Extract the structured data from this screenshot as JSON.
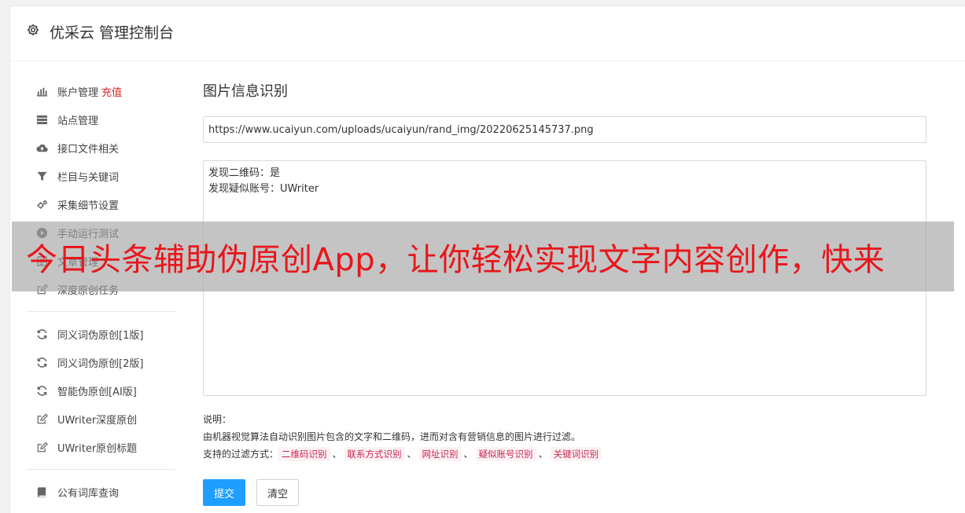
{
  "header": {
    "title": "优采云 管理控制台",
    "icon": "gear-icon"
  },
  "sidebar": {
    "groups": [
      [
        {
          "label": "账户管理",
          "badge": "充值",
          "icon": "bar-chart-icon"
        },
        {
          "label": "站点管理",
          "icon": "server-icon"
        },
        {
          "label": "接口文件相关",
          "icon": "cloud-upload-icon"
        },
        {
          "label": "栏目与关键词",
          "icon": "filter-icon"
        },
        {
          "label": "采集细节设置",
          "icon": "gears-icon"
        },
        {
          "label": "手动运行测试",
          "icon": "play-circle-icon"
        },
        {
          "label": "文章管理",
          "icon": "article-icon"
        },
        {
          "label": "深度原创任务",
          "icon": "edit-icon"
        }
      ],
      [
        {
          "label": "同义词伪原创[1版]",
          "icon": "refresh-icon"
        },
        {
          "label": "同义词伪原创[2版]",
          "icon": "refresh-icon"
        },
        {
          "label": "智能伪原创[AI版]",
          "icon": "refresh-icon"
        },
        {
          "label": "UWriter深度原创",
          "icon": "edit-icon"
        },
        {
          "label": "UWriter原创标题",
          "icon": "edit-icon"
        }
      ],
      [
        {
          "label": "公有词库查询",
          "icon": "book-icon"
        }
      ]
    ]
  },
  "main": {
    "title": "图片信息识别",
    "url_value": "https://www.ucaiyun.com/uploads/ucaiyun/rand_img/20220625145737.png",
    "result_lines": [
      "发现二维码：是",
      "发现疑似账号：UWriter"
    ],
    "desc_label": "说明：",
    "desc_text": "由机器视觉算法自动识别图片包含的文字和二维码，进而对含有营销信息的图片进行过滤。",
    "filter_label": "支持的过滤方式：",
    "filter_tags": [
      "二维码识别",
      "联系方式识别",
      "网址识别",
      "疑似账号识别",
      "关键词识别"
    ],
    "filter_sep": "、",
    "submit_label": "提交",
    "clear_label": "清空"
  },
  "banner": {
    "text": "今日头条辅助伪原创App，让你轻松实现文字内容创作，快来"
  },
  "colors": {
    "primary": "#1e9fff",
    "badge": "#e02020",
    "tag_text": "#c7254e",
    "tag_bg": "#fdf2f4",
    "banner_text": "#e8161b"
  }
}
